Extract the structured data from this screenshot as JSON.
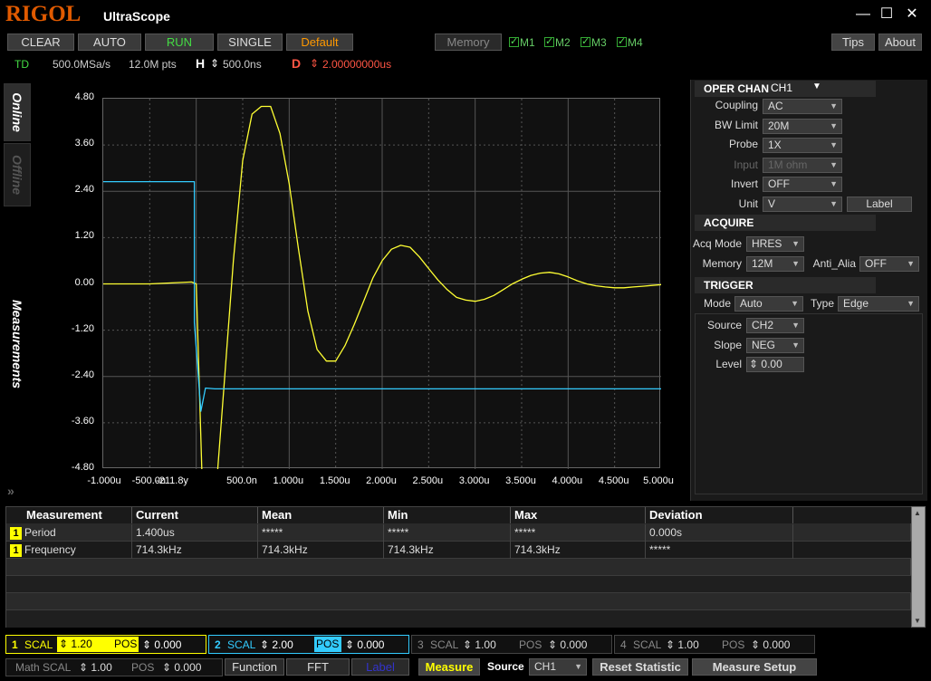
{
  "app": {
    "logo": "RIGOL",
    "name": "UltraScope",
    "minimize": "—",
    "maximize": "☐",
    "close": "✕"
  },
  "toolbar": {
    "clear": "CLEAR",
    "auto": "AUTO",
    "run": "RUN",
    "single": "SINGLE",
    "default": "Default",
    "memory": "Memory",
    "m1": "M1",
    "m2": "M2",
    "m3": "M3",
    "m4": "M4",
    "tips": "Tips",
    "about": "About"
  },
  "info": {
    "td": "TD",
    "sample_rate": "500.0MSa/s",
    "points": "12.0M pts",
    "h_label": "H",
    "h_value": "500.0ns",
    "d_label": "D",
    "d_value": "2.00000000us"
  },
  "side_tabs": {
    "online": "Online",
    "offline": "Offline",
    "measurements": "Measurements"
  },
  "chart_data": {
    "type": "line",
    "xlabel": "",
    "ylabel": "",
    "x_ticks": [
      "-1.000u",
      "-500.0n",
      "-211.8y",
      "500.0n",
      "1.000u",
      "1.500u",
      "2.000u",
      "2.500u",
      "3.000u",
      "3.500u",
      "4.000u",
      "4.500u",
      "5.000u"
    ],
    "y_ticks": [
      "4.80",
      "3.60",
      "2.40",
      "1.20",
      "0.00",
      "-1.20",
      "-2.40",
      "-3.60",
      "-4.80"
    ],
    "xlim": [
      -1.0,
      5.0
    ],
    "ylim": [
      -4.8,
      4.8
    ],
    "x_unit": "us",
    "grid": true,
    "series": [
      {
        "channel": "CH1",
        "color": "#ffff33",
        "x": [
          -1.0,
          -0.5,
          -0.05,
          0.0,
          0.1,
          0.2,
          0.3,
          0.4,
          0.5,
          0.6,
          0.7,
          0.8,
          0.9,
          1.0,
          1.1,
          1.2,
          1.3,
          1.4,
          1.5,
          1.6,
          1.7,
          1.8,
          1.9,
          2.0,
          2.1,
          2.2,
          2.3,
          2.4,
          2.5,
          2.6,
          2.7,
          2.8,
          2.9,
          3.0,
          3.1,
          3.2,
          3.3,
          3.4,
          3.5,
          3.6,
          3.7,
          3.8,
          3.9,
          4.0,
          4.1,
          4.2,
          4.3,
          4.4,
          4.5,
          4.6,
          4.7,
          4.8,
          4.9,
          5.0
        ],
        "y": [
          0.0,
          0.0,
          0.05,
          0.0,
          -8.0,
          -5.8,
          -2.6,
          0.6,
          3.2,
          4.4,
          4.6,
          4.6,
          3.9,
          2.6,
          0.9,
          -0.7,
          -1.7,
          -2.0,
          -2.0,
          -1.6,
          -1.05,
          -0.45,
          0.15,
          0.6,
          0.9,
          1.0,
          0.95,
          0.7,
          0.4,
          0.1,
          -0.15,
          -0.35,
          -0.42,
          -0.45,
          -0.4,
          -0.3,
          -0.15,
          0.0,
          0.12,
          0.22,
          0.28,
          0.3,
          0.26,
          0.18,
          0.08,
          0.0,
          -0.05,
          -0.08,
          -0.1,
          -0.1,
          -0.08,
          -0.06,
          -0.04,
          -0.02
        ]
      },
      {
        "channel": "CH2",
        "color": "#33ccff",
        "x": [
          -1.0,
          -0.5,
          -0.02,
          -0.02,
          0.05,
          0.1,
          0.2,
          0.5,
          1.0,
          2.0,
          3.0,
          4.0,
          5.0
        ],
        "y": [
          2.65,
          2.65,
          2.65,
          -1.0,
          -3.3,
          -2.7,
          -2.72,
          -2.72,
          -2.72,
          -2.72,
          -2.72,
          -2.72,
          -2.72
        ]
      }
    ]
  },
  "oper_chan": {
    "title": "OPER CHAN",
    "channel": "CH1",
    "coupling_label": "Coupling",
    "coupling": "AC",
    "bw_label": "BW Limit",
    "bw": "20M",
    "probe_label": "Probe",
    "probe": "1X",
    "input_label": "Input",
    "input": "1M ohm",
    "invert_label": "Invert",
    "invert": "OFF",
    "unit_label": "Unit",
    "unit": "V",
    "label_btn": "Label"
  },
  "acquire": {
    "title": "ACQUIRE",
    "mode_label": "Acq Mode",
    "mode": "HRES",
    "memory_label": "Memory",
    "memory": "12M",
    "anti_label": "Anti_Alia",
    "anti": "OFF"
  },
  "trigger": {
    "title": "TRIGGER",
    "mode_label": "Mode",
    "mode": "Auto",
    "type_label": "Type",
    "type": "Edge",
    "source_label": "Source",
    "source": "CH2",
    "slope_label": "Slope",
    "slope": "NEG",
    "level_label": "Level",
    "level": "0.00"
  },
  "measure_table": {
    "headers": [
      "Measurement",
      "Current",
      "Mean",
      "Min",
      "Max",
      "Deviation"
    ],
    "rows": [
      {
        "ch": "1",
        "name": "Period",
        "current": "1.400us",
        "mean": "*****",
        "min": "*****",
        "max": "*****",
        "dev": "0.000s"
      },
      {
        "ch": "1",
        "name": "Frequency",
        "current": "714.3kHz",
        "mean": "714.3kHz",
        "min": "714.3kHz",
        "max": "714.3kHz",
        "dev": "*****"
      }
    ]
  },
  "channels": [
    {
      "num": "1",
      "scal_label": "SCAL",
      "scal": "1.20",
      "pos_label": "POS",
      "pos": "0.000",
      "color": "#ffff00"
    },
    {
      "num": "2",
      "scal_label": "SCAL",
      "scal": "2.00",
      "pos_label": "POS",
      "pos": "0.000",
      "color": "#33ccff"
    },
    {
      "num": "3",
      "scal_label": "SCAL",
      "scal": "1.00",
      "pos_label": "POS",
      "pos": "0.000",
      "color": "#888888"
    },
    {
      "num": "4",
      "scal_label": "SCAL",
      "scal": "1.00",
      "pos_label": "POS",
      "pos": "0.000",
      "color": "#888888"
    }
  ],
  "bottom": {
    "math_label": "Math SCAL",
    "math_scal": "1.00",
    "pos_label": "POS",
    "pos": "0.000",
    "function": "Function",
    "fft": "FFT",
    "label": "Label",
    "measure": "Measure",
    "source_label": "Source",
    "source": "CH1",
    "reset": "Reset  Statistic",
    "setup": "Measure Setup"
  }
}
